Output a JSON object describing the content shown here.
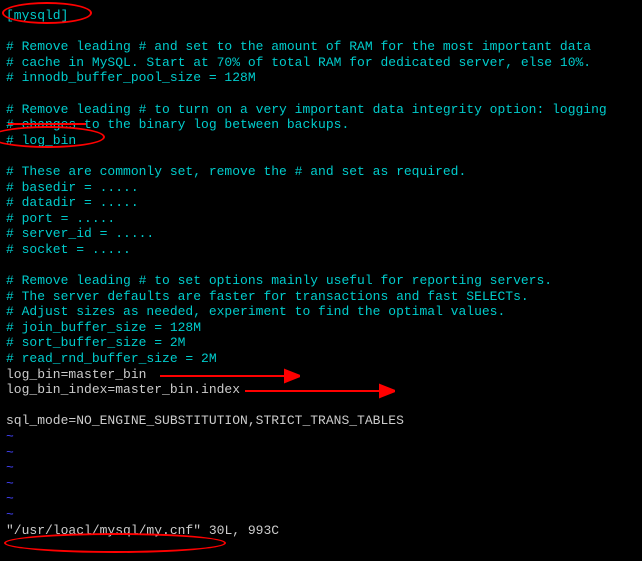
{
  "lines": {
    "l0": "[mysqld]",
    "l1": "",
    "l2": "# Remove leading # and set to the amount of RAM for the most important data",
    "l3": "# cache in MySQL. Start at 70% of total RAM for dedicated server, else 10%.",
    "l4": "# innodb_buffer_pool_size = 128M",
    "l5": "",
    "l6": "# Remove leading # to turn on a very important data integrity option: logging",
    "l7": "# changes to the binary log between backups.",
    "l8": "# log_bin",
    "l9": "",
    "l10": "# These are commonly set, remove the # and set as required.",
    "l11": "# basedir = .....",
    "l12": "# datadir = .....",
    "l13": "# port = .....",
    "l14": "# server_id = .....",
    "l15": "# socket = .....",
    "l16": "",
    "l17": "# Remove leading # to set options mainly useful for reporting servers.",
    "l18": "# The server defaults are faster for transactions and fast SELECTs.",
    "l19": "# Adjust sizes as needed, experiment to find the optimal values.",
    "l20": "# join_buffer_size = 128M",
    "l21": "# sort_buffer_size = 2M",
    "l22": "# read_rnd_buffer_size = 2M",
    "l23": "log_bin=master_bin",
    "l24": "log_bin_index=master_bin.index",
    "l25": "",
    "l26": "sql_mode=NO_ENGINE_SUBSTITUTION,STRICT_TRANS_TABLES",
    "tilde": "~",
    "status_path": "\"/usr/loacl/mysql/my.cnf\"",
    "status_info": " 30L, 993C"
  }
}
